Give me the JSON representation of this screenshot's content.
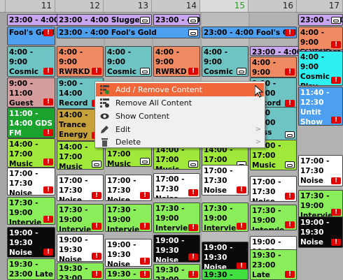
{
  "colors": {
    "purple": "#c8a6f0",
    "blue": "#4da0f0",
    "salmon": "#f08a62",
    "teal": "#6ec3c3",
    "pink": "#d49c9c",
    "green": "#1aa32e",
    "lime": "#a0e83a",
    "white": "#ffffff",
    "black": "#0a0a0a",
    "cyan": "#2ef0f0",
    "olive": "#c7a23a",
    "lightgreen": "#8aee5a",
    "brightgreen": "#3fe03f",
    "highlight": "#f0683a"
  },
  "days": [
    "11",
    "12",
    "13",
    "14",
    "15",
    "16",
    "17"
  ],
  "today_index": 4,
  "events": [
    {
      "text": "23:00 - 4:00 Sluggers",
      "icon": "link-icon",
      "color": "purple"
    },
    {
      "text": "23:00 - 4:00 Sluggers",
      "icon": "link-icon",
      "color": "purple"
    },
    {
      "text": "23:00 - 4:00 Sluggers",
      "icon": "link-icon",
      "color": "purple"
    },
    {
      "text": "23:00 - 4:00 Sluggers",
      "icon": "link-icon",
      "color": "purple"
    },
    {
      "text": "Fool's Gold",
      "icon": "warning-icon",
      "color": "blue"
    },
    {
      "text": "23:00 - 4:00 Fool's Gold",
      "icon": "link-icon",
      "color": "blue"
    },
    {
      "text": "23:00 - 4:00 Fool's Gold",
      "icon": "warning-icon",
      "color": "blue"
    },
    {
      "text": "4:00 -\n9:00 Cosmic\nDebris",
      "icon": "warning-icon",
      "color": "teal"
    },
    {
      "text": "4:00 -\n9:00 RWRKD",
      "icon": "warning-icon",
      "color": "salmon"
    },
    {
      "text": "4:00 -\n9:00 Cosmic\nDebris",
      "icon": "link-icon",
      "color": "teal"
    },
    {
      "text": "4:00 -\n9:00 RWRKD",
      "icon": "warning-icon",
      "color": "salmon"
    },
    {
      "text": "4:00 -\n9:00 Cosmic\nDebris",
      "icon": "link-icon",
      "color": "teal"
    },
    {
      "text": "23:00 - 4:00 Sluggers",
      "icon": "",
      "color": "purple"
    },
    {
      "text": "4:00 -\n9:00 RWRKD",
      "icon": "warning-icon",
      "color": "salmon"
    },
    {
      "text": "4:00 -\n9:00 RWRKD",
      "icon": "warning-icon",
      "color": "salmon"
    },
    {
      "text": "4:00 -\n9:00 Cosmic\nPlay",
      "icon": "warning-icon",
      "color": "cyan"
    },
    {
      "text": "9:00 -\n11:00 Guest\nDJ",
      "icon": "warning-icon",
      "color": "pink"
    },
    {
      "text": "9:00 -\n14:00 Record\nPlay",
      "icon": "warning-icon",
      "color": "teal"
    },
    {
      "text": "9:00 -\n14:00 Record",
      "icon": "warning-icon",
      "color": "teal"
    },
    {
      "text": "9:00\n14:00 Ness",
      "icon": "link-icon",
      "color": "teal"
    },
    {
      "text": "11:40 -\n12:30 Untit\nShow",
      "icon": "warning-icon",
      "color": "blue"
    },
    {
      "text": "11:00 -\n14:00 GDS\nFM",
      "icon": "warning-icon",
      "color": "green"
    },
    {
      "text": "14:00 - Trance\nEnergy\nRadio",
      "icon": "warning-icon",
      "color": "olive"
    },
    {
      "text": "14:00 -\n17:00 Music",
      "icon": "warning-icon",
      "color": "lime"
    },
    {
      "text": "14:00 -\n17:00 Music",
      "icon": "link-icon",
      "color": "lime"
    },
    {
      "text": "14:00 -\n17:00 Music",
      "icon": "link-icon",
      "color": "lime"
    },
    {
      "text": "14:00 -\n17:00 Music",
      "icon": "link-icon",
      "color": "lime"
    },
    {
      "text": "14:00 -\n17:00 Music",
      "icon": "link-icon",
      "color": "lime"
    },
    {
      "text": "14:00 -\n17:00 Music",
      "icon": "link-icon",
      "color": "lime"
    },
    {
      "text": "17:00 -\n17:30 Noise\nAbates",
      "icon": "warning-icon",
      "color": "white"
    },
    {
      "text": "17:00 -\n17:30 Noise\nAbates",
      "icon": "warning-icon",
      "color": "white"
    },
    {
      "text": "17:00 -\n17:30 Noise\nAbates",
      "icon": "warning-icon",
      "color": "white"
    },
    {
      "text": "17:00 -\n17:30 Noise\nAbates",
      "icon": "warning-icon",
      "color": "white"
    },
    {
      "text": "17:00 -\n17:30 Noise\nAbates",
      "icon": "warning-icon",
      "color": "white"
    },
    {
      "text": "17:00 -\n17:30 Noise\nAbates",
      "icon": "warning-icon",
      "color": "white"
    },
    {
      "text": "17:00 -\n17:30 Noise\nAbates",
      "icon": "warning-icon",
      "color": "white"
    },
    {
      "text": "17:30 -\n19:00 Intervie",
      "icon": "warning-icon",
      "color": "lightgreen"
    },
    {
      "text": "17:30 -\n19:00 Intervie",
      "icon": "warning-icon",
      "color": "lightgreen"
    },
    {
      "text": "17:30 -\n19:00 Intervie",
      "icon": "warning-icon",
      "color": "lightgreen"
    },
    {
      "text": "17:30 -\n19:00 Intervie",
      "icon": "warning-icon",
      "color": "lightgreen"
    },
    {
      "text": "17:30 -\n19:00 Intervie",
      "icon": "warning-icon",
      "color": "lightgreen"
    },
    {
      "text": "17:30 -\n19:00 Intervie",
      "icon": "warning-icon",
      "color": "lightgreen"
    },
    {
      "text": "17:30 -\n19:00 Intervie",
      "icon": "warning-icon",
      "color": "lightgreen"
    },
    {
      "text": "19:00 -\n19:30 Noise\nAbates",
      "icon": "warning-icon",
      "color": "black"
    },
    {
      "text": "19:00 -\n19:30 Noise\nAbates",
      "icon": "warning-icon",
      "color": "white"
    },
    {
      "text": "19:00 -\n19:30 Noise\nAbates",
      "icon": "warning-icon",
      "color": "white"
    },
    {
      "text": "19:00 -\n19:30 Noise\nAbates",
      "icon": "warning-icon",
      "color": "black"
    },
    {
      "text": "19:00 -\n19:30 Noise\nAbates",
      "icon": "warning-icon",
      "color": "black"
    },
    {
      "text": "19:00 -\n19:30 Noise\nAbates",
      "icon": "warning-icon",
      "color": "white"
    },
    {
      "text": "19:00 -\n19:30 Noise\nAbates",
      "icon": "warning-icon",
      "color": "black"
    },
    {
      "text": "19:30 -\n23:00 Late",
      "icon": "",
      "color": "lightgreen"
    },
    {
      "text": "19:30 -\n23:00",
      "icon": "warning-icon",
      "color": "lightgreen"
    },
    {
      "text": "19:30 -\n23:00",
      "icon": "warning-icon",
      "color": "lightgreen"
    },
    {
      "text": "19:30 -\n23:00",
      "icon": "warning-icon",
      "color": "lightgreen"
    },
    {
      "text": "19:30 -\n23:00",
      "icon": "",
      "color": "brightgreen"
    },
    {
      "text": "19:30 -\n23:00 Late\nNight",
      "icon": "warning-icon",
      "color": "lightgreen"
    }
  ],
  "menu": {
    "items": [
      {
        "label": "Add / Remove Content",
        "icon": "add-remove-content-icon",
        "submenu": false,
        "highlighted": true
      },
      {
        "label": "Remove All Content",
        "icon": "remove-all-content-icon",
        "submenu": false,
        "highlighted": false
      },
      {
        "label": "Show Content",
        "icon": "eye-icon",
        "submenu": false,
        "highlighted": false
      },
      {
        "label": "Edit",
        "icon": "pencil-icon",
        "submenu": true,
        "highlighted": false
      },
      {
        "label": "Delete",
        "icon": "trash-icon",
        "submenu": true,
        "highlighted": false
      }
    ]
  }
}
